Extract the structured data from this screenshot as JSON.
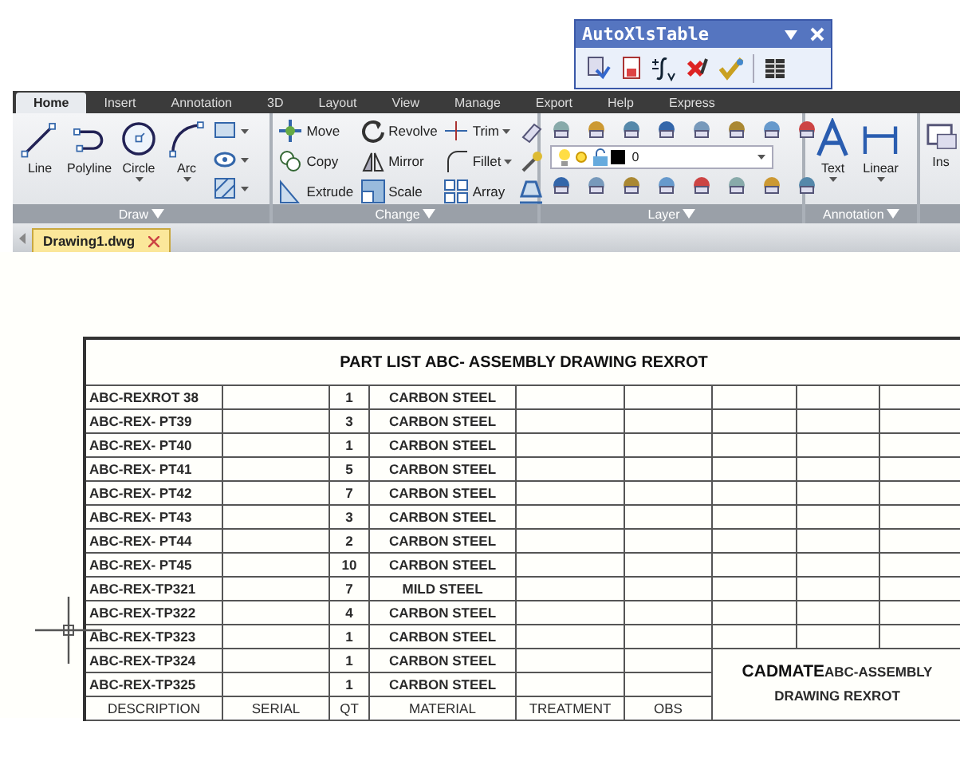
{
  "floating_toolbar": {
    "title": "AutoXlsTable"
  },
  "ribbon": {
    "tabs": [
      {
        "label": "Home",
        "selected": true
      },
      {
        "label": "Insert",
        "selected": false
      },
      {
        "label": "Annotation",
        "selected": false
      },
      {
        "label": "3D",
        "selected": false
      },
      {
        "label": "Layout",
        "selected": false
      },
      {
        "label": "View",
        "selected": false
      },
      {
        "label": "Manage",
        "selected": false
      },
      {
        "label": "Export",
        "selected": false
      },
      {
        "label": "Help",
        "selected": false
      },
      {
        "label": "Express",
        "selected": false
      }
    ],
    "panels": [
      {
        "kind": "draw",
        "title": "Draw",
        "tools": [
          {
            "kind": "large",
            "label": "Line",
            "dropdown": false
          },
          {
            "kind": "large",
            "label": "Polyline",
            "dropdown": false
          },
          {
            "kind": "large",
            "label": "Circle",
            "dropdown": true
          },
          {
            "kind": "large",
            "label": "Arc",
            "dropdown": true
          },
          {
            "kind": "icon",
            "dropdown": true
          },
          {
            "kind": "icon",
            "dropdown": true
          },
          {
            "kind": "icon",
            "dropdown": true
          }
        ]
      },
      {
        "kind": "change",
        "title": "Change",
        "tools": [
          {
            "kind": "small",
            "label": "Move",
            "dropdown": false
          },
          {
            "kind": "small",
            "label": "Revolve",
            "dropdown": false
          },
          {
            "kind": "small",
            "label": "Trim",
            "dropdown": true
          },
          {
            "kind": "icon",
            "dropdown": false
          },
          {
            "kind": "small",
            "label": "Copy",
            "dropdown": false
          },
          {
            "kind": "small",
            "label": "Mirror",
            "dropdown": false
          },
          {
            "kind": "small",
            "label": "Fillet",
            "dropdown": true
          },
          {
            "kind": "icon",
            "dropdown": false
          },
          {
            "kind": "small",
            "label": "Extrude",
            "dropdown": false
          },
          {
            "kind": "small",
            "label": "Scale",
            "dropdown": false
          },
          {
            "kind": "small",
            "label": "Array",
            "dropdown": false
          },
          {
            "kind": "icon",
            "dropdown": false
          }
        ]
      },
      {
        "kind": "layer",
        "title": "Layer",
        "layer_select": {
          "value": "0"
        }
      },
      {
        "kind": "annotation",
        "title": "Annotation",
        "tools": [
          {
            "kind": "large",
            "label": "Text",
            "dropdown": true
          },
          {
            "kind": "large",
            "label": "Linear",
            "dropdown": true
          }
        ]
      },
      {
        "kind": "insert",
        "tools": [
          {
            "kind": "large",
            "label": "Ins",
            "dropdown": false
          }
        ]
      }
    ]
  },
  "document_tabs": [
    {
      "label": "Drawing1.dwg",
      "selected": true
    }
  ],
  "part_list": {
    "title": "PART LIST ABC- ASSEMBLY DRAWING REXROT",
    "rows": [
      {
        "description": "ABC-REXROT 38",
        "qt": "1",
        "material": "CARBON STEEL"
      },
      {
        "description": "ABC-REX- PT39",
        "qt": "3",
        "material": "CARBON STEEL"
      },
      {
        "description": "ABC-REX- PT40",
        "qt": "1",
        "material": "CARBON STEEL"
      },
      {
        "description": "ABC-REX- PT41",
        "qt": "5",
        "material": "CARBON STEEL"
      },
      {
        "description": "ABC-REX- PT42",
        "qt": "7",
        "material": "CARBON STEEL"
      },
      {
        "description": "ABC-REX- PT43",
        "qt": "3",
        "material": "CARBON STEEL"
      },
      {
        "description": "ABC-REX- PT44",
        "qt": "2",
        "material": "CARBON STEEL"
      },
      {
        "description": "ABC-REX- PT45",
        "qt": "10",
        "material": "CARBON STEEL"
      },
      {
        "description": "ABC-REX-TP321",
        "qt": "7",
        "material": "MILD STEEL"
      },
      {
        "description": "ABC-REX-TP322",
        "qt": "4",
        "material": "CARBON STEEL"
      },
      {
        "description": "ABC-REX-TP323",
        "qt": "1",
        "material": "CARBON STEEL"
      },
      {
        "description": "ABC-REX-TP324",
        "qt": "1",
        "material": "CARBON STEEL"
      },
      {
        "description": "ABC-REX-TP325",
        "qt": "1",
        "material": "CARBON STEEL"
      }
    ],
    "columns": [
      "DESCRIPTION",
      "SERIAL",
      "QT",
      "MATERIAL",
      "TREATMENT",
      "OBS"
    ],
    "title_block": {
      "brand": "CADMATE",
      "text": "ABC-ASSEMBLY DRAWING REXROT"
    }
  }
}
